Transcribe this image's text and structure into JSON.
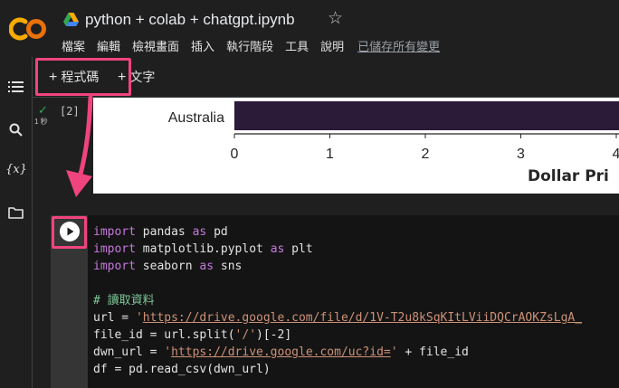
{
  "header": {
    "title": "python + colab + chatgpt.ipynb",
    "menu": [
      "檔案",
      "編輯",
      "檢視畫面",
      "插入",
      "執行階段",
      "工具",
      "說明"
    ],
    "saved_status": "已儲存所有變更"
  },
  "toolbar": {
    "add_code_label": "程式碼",
    "add_text_label": "文字"
  },
  "sidebar": {
    "items": [
      {
        "icon": "menu-icon"
      },
      {
        "icon": "search-icon"
      },
      {
        "icon": "variables-icon",
        "label": "{x}"
      },
      {
        "icon": "folder-icon"
      }
    ]
  },
  "output_cell": {
    "execution_count": "[2]",
    "execution_time": "1 秒"
  },
  "chart_data": {
    "type": "bar",
    "orientation": "horizontal",
    "categories": [
      "Australia"
    ],
    "values": [
      4.2
    ],
    "xticks": [
      "0",
      "1",
      "2",
      "3",
      "4"
    ],
    "xlabel": "Dollar Pri",
    "xlim": [
      0,
      4
    ],
    "bar_color": "#2b1a38"
  },
  "code_cell": {
    "lines": [
      [
        {
          "t": "import",
          "c": "kw"
        },
        {
          "t": " pandas "
        },
        {
          "t": "as",
          "c": "kw"
        },
        {
          "t": " pd"
        }
      ],
      [
        {
          "t": "import",
          "c": "kw"
        },
        {
          "t": " matplotlib.pyplot "
        },
        {
          "t": "as",
          "c": "kw"
        },
        {
          "t": " plt"
        }
      ],
      [
        {
          "t": "import",
          "c": "kw"
        },
        {
          "t": " seaborn "
        },
        {
          "t": "as",
          "c": "kw"
        },
        {
          "t": " sns"
        }
      ],
      [],
      [
        {
          "t": "# 讀取資料",
          "c": "cm"
        }
      ],
      [
        {
          "t": "url = "
        },
        {
          "t": "'",
          "c": "st"
        },
        {
          "t": "https://drive.google.com/file/d/1V-T2u8kSqKItLViiDQCrAOKZsLgA_",
          "c": "st url"
        }
      ],
      [
        {
          "t": "file_id = url.split("
        },
        {
          "t": "'/'",
          "c": "st"
        },
        {
          "t": ")[-2]"
        }
      ],
      [
        {
          "t": "dwn_url = "
        },
        {
          "t": "'",
          "c": "st"
        },
        {
          "t": "https://drive.google.com/uc?id=",
          "c": "st url"
        },
        {
          "t": "'",
          "c": "st"
        },
        {
          "t": " + file_id"
        }
      ],
      [
        {
          "t": "df = pd.read_csv(dwn_url)"
        }
      ]
    ]
  },
  "colors": {
    "background": "#1f1f1f",
    "highlight": "#f0447e",
    "keyword": "#c678dd",
    "comment": "#7ec699",
    "string": "#ce9178",
    "check": "#34a853"
  }
}
